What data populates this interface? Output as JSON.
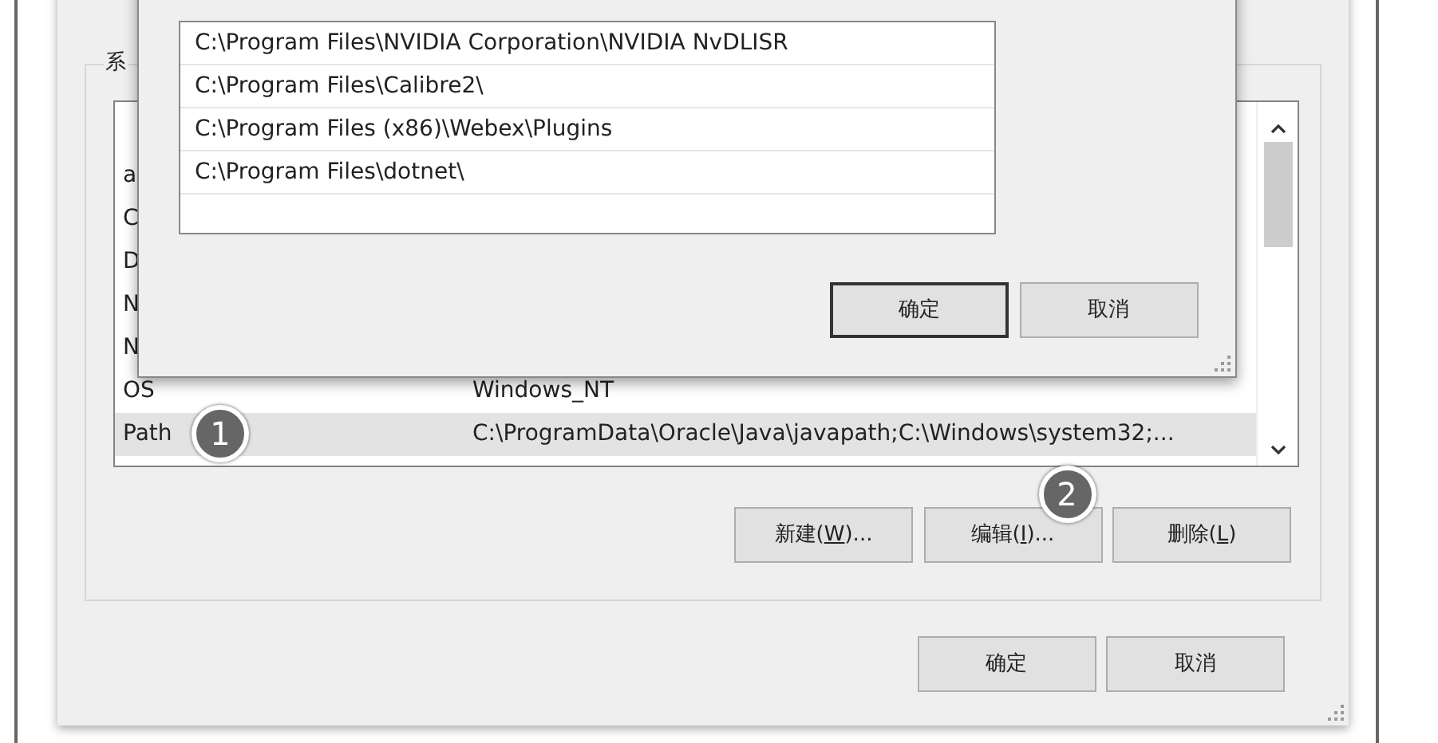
{
  "main_dialog": {
    "group_label": "系",
    "variables": {
      "rows": [
        {
          "name": "a",
          "selected": false
        },
        {
          "name": "C",
          "selected": false
        },
        {
          "name": "D",
          "selected": false
        },
        {
          "name": "N",
          "selected": false
        },
        {
          "name": "N",
          "selected": false
        },
        {
          "name": "OS",
          "value": "Windows_NT",
          "selected": false
        },
        {
          "name": "Path",
          "value": "C:\\ProgramData\\Oracle\\Java\\javapath;C:\\Windows\\system32;...",
          "selected": true,
          "callout": "1"
        }
      ]
    },
    "group_buttons": [
      {
        "before": "新建(",
        "key": "W",
        "after": ")..."
      },
      {
        "before": "编辑(",
        "key": "I",
        "after": ")...",
        "callout": "2"
      },
      {
        "before": "删除(",
        "key": "L",
        "after": ")"
      }
    ],
    "buttons": [
      {
        "label": "确定",
        "default": false
      },
      {
        "label": "取消",
        "default": false
      }
    ]
  },
  "edit_dialog": {
    "entries": [
      {
        "text": "C:\\Program Files\\NVIDIA Corporation\\NVIDIA NvDLISR"
      },
      {
        "text": "C:\\Program Files\\Calibre2\\"
      },
      {
        "text": "C:\\Program Files (x86)\\Webex\\Plugins"
      },
      {
        "text": "C:\\Program Files\\dotnet\\"
      }
    ],
    "buttons": [
      {
        "label": "确定",
        "default": true
      },
      {
        "label": "取消",
        "default": false
      }
    ]
  }
}
